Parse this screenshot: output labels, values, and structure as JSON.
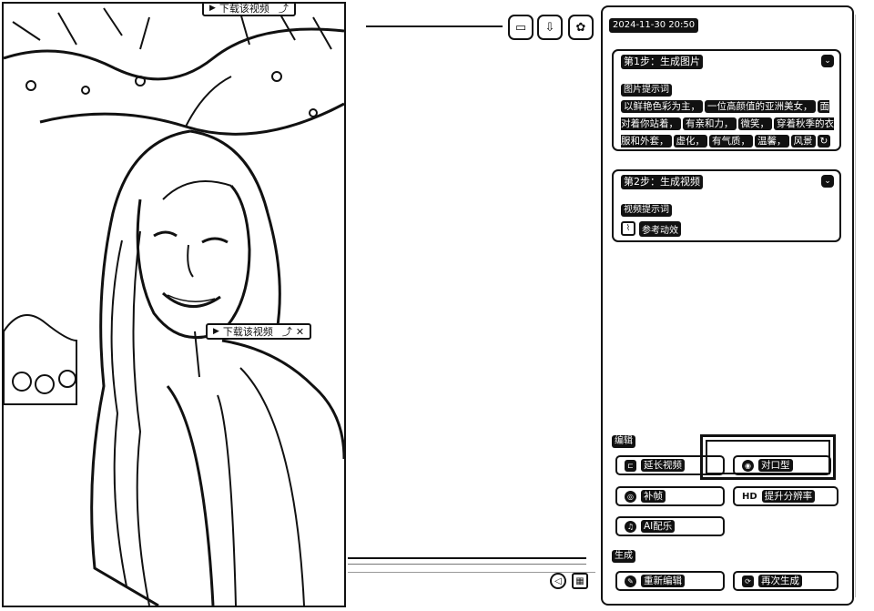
{
  "video": {
    "download_label": "下载该视频",
    "download_top_label": "下载该视频",
    "download_icon": "play-triangle-icon",
    "extra_icons": [
      "share-icon",
      "close-icon"
    ]
  },
  "toolbar": {
    "buttons": [
      {
        "name": "subtitle-icon",
        "glyph": "▭"
      },
      {
        "name": "download-icon",
        "glyph": "⇩"
      },
      {
        "name": "settings-icon",
        "glyph": "✿"
      }
    ]
  },
  "panel": {
    "timestamp": "2024-11-30 20:50",
    "step1": {
      "title": "第1步：生成图片",
      "collapse_glyph": "⌄",
      "sub_label": "图片提示词",
      "prompt_parts": [
        "以鲜艳色彩为主，",
        "一位高颜值的亚洲美女，",
        "面对着你站着，",
        "有亲和力，",
        "微笑，",
        "穿着秋季的衣服和外套，",
        "虚化，",
        "有气质，",
        "温馨，",
        "风景"
      ],
      "edit_icon": "refresh-icon"
    },
    "step2": {
      "title": "第2步：生成视频",
      "collapse_glyph": "⌄",
      "sub_label": "视频提示词",
      "ref_label": "参考动效"
    },
    "edit_section": {
      "label": "编辑",
      "buttons": [
        {
          "name": "extend-button",
          "label": "延长视频",
          "icon": "extend-icon",
          "glyph": "⊏"
        },
        {
          "name": "lip-sync-button",
          "label": "对口型",
          "icon": "eye-icon",
          "glyph": "◉"
        },
        {
          "name": "frame-fill-button",
          "label": "补帧",
          "icon": "frame-icon",
          "glyph": "◎"
        },
        {
          "name": "upscale-button",
          "label": "提升分辨率",
          "icon": "hd-icon",
          "glyph": "HD"
        },
        {
          "name": "ai-music-button",
          "label": "AI配乐",
          "icon": "music-icon",
          "glyph": "♫"
        }
      ]
    },
    "generate_section": {
      "label": "生成",
      "buttons": [
        {
          "name": "re-edit-button",
          "label": "重新编辑",
          "icon": "edit-icon",
          "glyph": "✎"
        },
        {
          "name": "regenerate-button",
          "label": "再次生成",
          "icon": "refresh-icon",
          "glyph": "⟳"
        }
      ]
    }
  },
  "timeline": {
    "volume_icon": "◁",
    "grid_icon": "▦"
  }
}
